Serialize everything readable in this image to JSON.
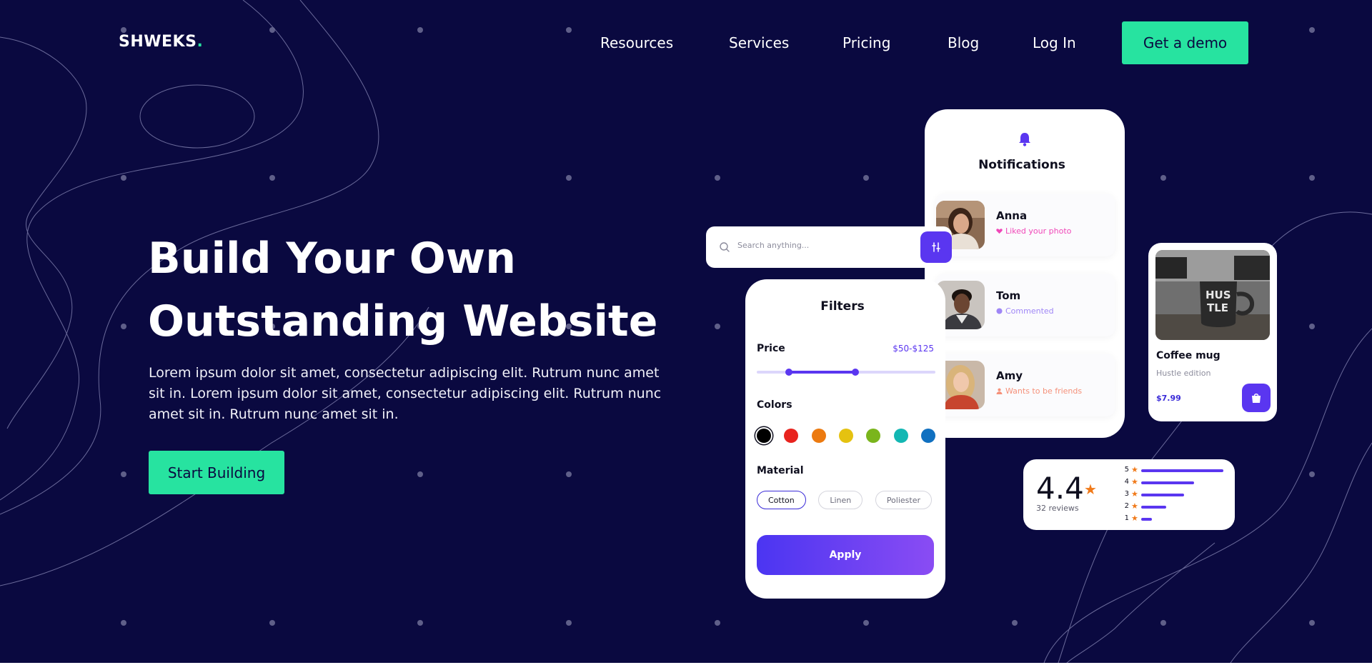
{
  "brand": {
    "name": "SHWEKS",
    "dot": "."
  },
  "nav": {
    "items": [
      {
        "label": "Resources"
      },
      {
        "label": "Services"
      },
      {
        "label": "Pricing"
      },
      {
        "label": "Blog"
      },
      {
        "label": "Log In"
      }
    ],
    "cta_label": "Get a demo"
  },
  "hero": {
    "title_line1": "Build Your Own",
    "title_line2": "Outstanding Website",
    "body": "Lorem ipsum dolor sit amet, consectetur adipiscing elit. Rutrum nunc amet sit in. Lorem ipsum dolor sit amet, consectetur adipiscing elit. Rutrum nunc amet sit in. Rutrum nunc amet sit in.",
    "cta_label": "Start Building"
  },
  "search": {
    "placeholder": "Search anything..."
  },
  "filters": {
    "title": "Filters",
    "price_label": "Price",
    "price_range": "$50-$125",
    "slider_min_fraction": 0.18,
    "slider_max_fraction": 0.55,
    "colors_label": "Colors",
    "swatches": [
      "#000000",
      "#e8231e",
      "#ec7a10",
      "#e5c210",
      "#7ab51c",
      "#13b7b3",
      "#1070c0"
    ],
    "selected_swatch": 0,
    "material_label": "Material",
    "materials": [
      {
        "label": "Cotton",
        "active": true
      },
      {
        "label": "Linen",
        "active": false
      },
      {
        "label": "Poliester",
        "active": false
      }
    ],
    "apply_label": "Apply"
  },
  "notifications": {
    "title": "Notifications",
    "items": [
      {
        "name": "Anna",
        "action": "Liked your photo",
        "color": "#f047b8",
        "icon": "heart-icon"
      },
      {
        "name": "Tom",
        "action": "Commented",
        "color": "#9f86f6",
        "icon": "comment-icon"
      },
      {
        "name": "Amy",
        "action": "Wants to be friends",
        "color": "#f5917a",
        "icon": "user-icon"
      }
    ]
  },
  "product": {
    "name": "Coffee mug",
    "subtitle": "Hustle edition",
    "price": "$7.99",
    "mug_text_1": "HUS",
    "mug_text_2": "TLE"
  },
  "rating": {
    "score": "4.4",
    "reviews": "32 reviews",
    "breakdown": [
      {
        "stars": "5",
        "fraction": 1.0
      },
      {
        "stars": "4",
        "fraction": 0.64
      },
      {
        "stars": "3",
        "fraction": 0.52
      },
      {
        "stars": "2",
        "fraction": 0.3
      },
      {
        "stars": "1",
        "fraction": 0.13
      }
    ]
  },
  "colors": {
    "background": "#0a0940",
    "accent_green": "#27e3a0",
    "accent_purple": "#5a36f0"
  }
}
